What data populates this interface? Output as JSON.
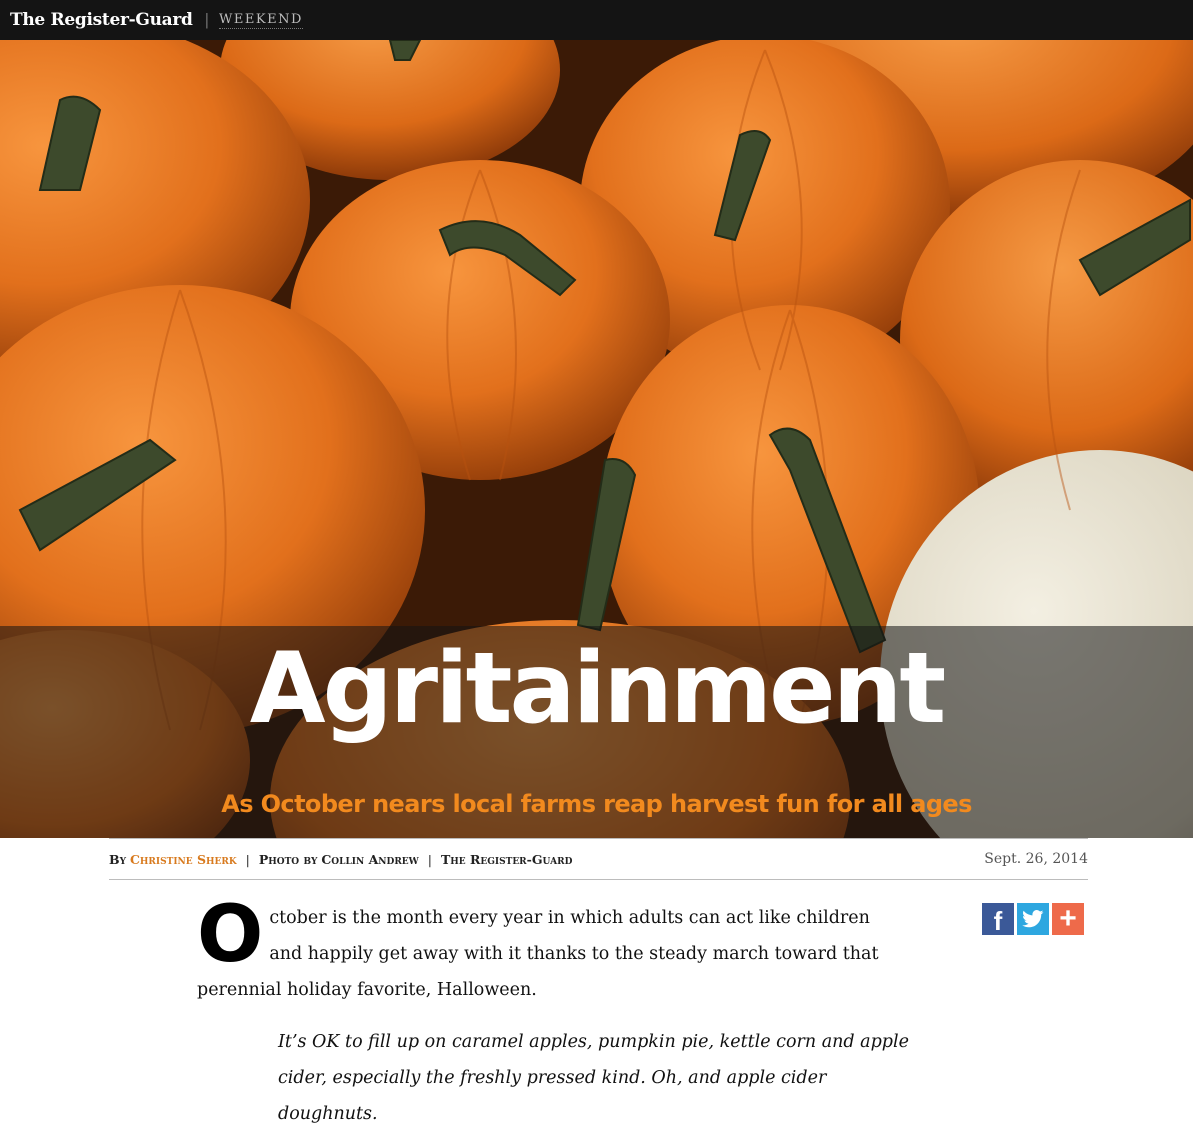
{
  "header": {
    "logo": "The Register-Guard",
    "separator": "|",
    "section": "WEEKEND"
  },
  "hero": {
    "headline": "Agritainment",
    "subhead": "As October nears local farms reap harvest fun for all ages"
  },
  "byline": {
    "by_label": "By",
    "author": "Christine Sherk",
    "photo_label": "Photo by",
    "photographer": "Collin Andrew",
    "publication": "The Register-Guard",
    "separator": "|",
    "date": "Sept. 26, 2014"
  },
  "share": {
    "facebook_glyph": "f",
    "twitter_icon": "twitter-bird-icon",
    "more_glyph": "+"
  },
  "article": {
    "dropcap": "O",
    "lede_rest": "ctober is the month every year in which adults can act like children and happily get away with it thanks to the steady march toward that perennial holiday favorite, Halloween.",
    "pullquote": "It’s OK to fill up on caramel apples, pumpkin pie, kettle corn and apple cider, especially the freshly pressed kind. Oh, and apple cider doughnuts."
  },
  "colors": {
    "topbar": "#141414",
    "accent_orange": "#f28a1e",
    "author_orange": "#d87a1e",
    "facebook": "#3b5998",
    "twitter": "#2ea7e0",
    "more": "#ee6a4a"
  }
}
